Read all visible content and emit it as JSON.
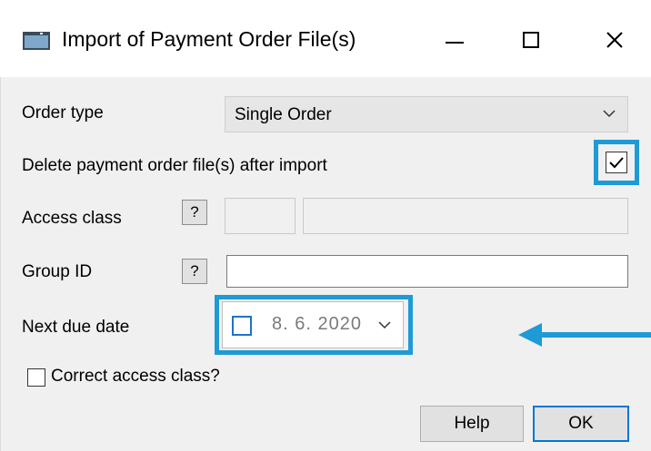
{
  "window": {
    "title": "Import of Payment Order File(s)",
    "icon": "app-window-icon",
    "controls": {
      "minimize_icon": "minimize-icon",
      "maximize_icon": "maximize-icon",
      "close_icon": "close-icon"
    }
  },
  "form": {
    "order_type": {
      "label": "Order type",
      "value": "Single Order"
    },
    "delete_after_import": {
      "label": "Delete payment order file(s) after import",
      "checked": true
    },
    "access_class": {
      "label": "Access class",
      "help": "?",
      "code": "",
      "name": ""
    },
    "group_id": {
      "label": "Group ID",
      "help": "?",
      "value": ""
    },
    "next_due_date": {
      "label": "Next due date",
      "value": "8.  6. 2020",
      "checked": false
    },
    "correct_access_class": {
      "label": "Correct access class?",
      "checked": false
    }
  },
  "buttons": {
    "help": "Help",
    "ok": "OK"
  },
  "colors": {
    "highlight": "#1e9ad6",
    "accent": "#0078d7",
    "dialog_bg": "#f0f0f0"
  },
  "annotations": {
    "arrow": "left-arrow",
    "highlight_boxes": 2
  }
}
